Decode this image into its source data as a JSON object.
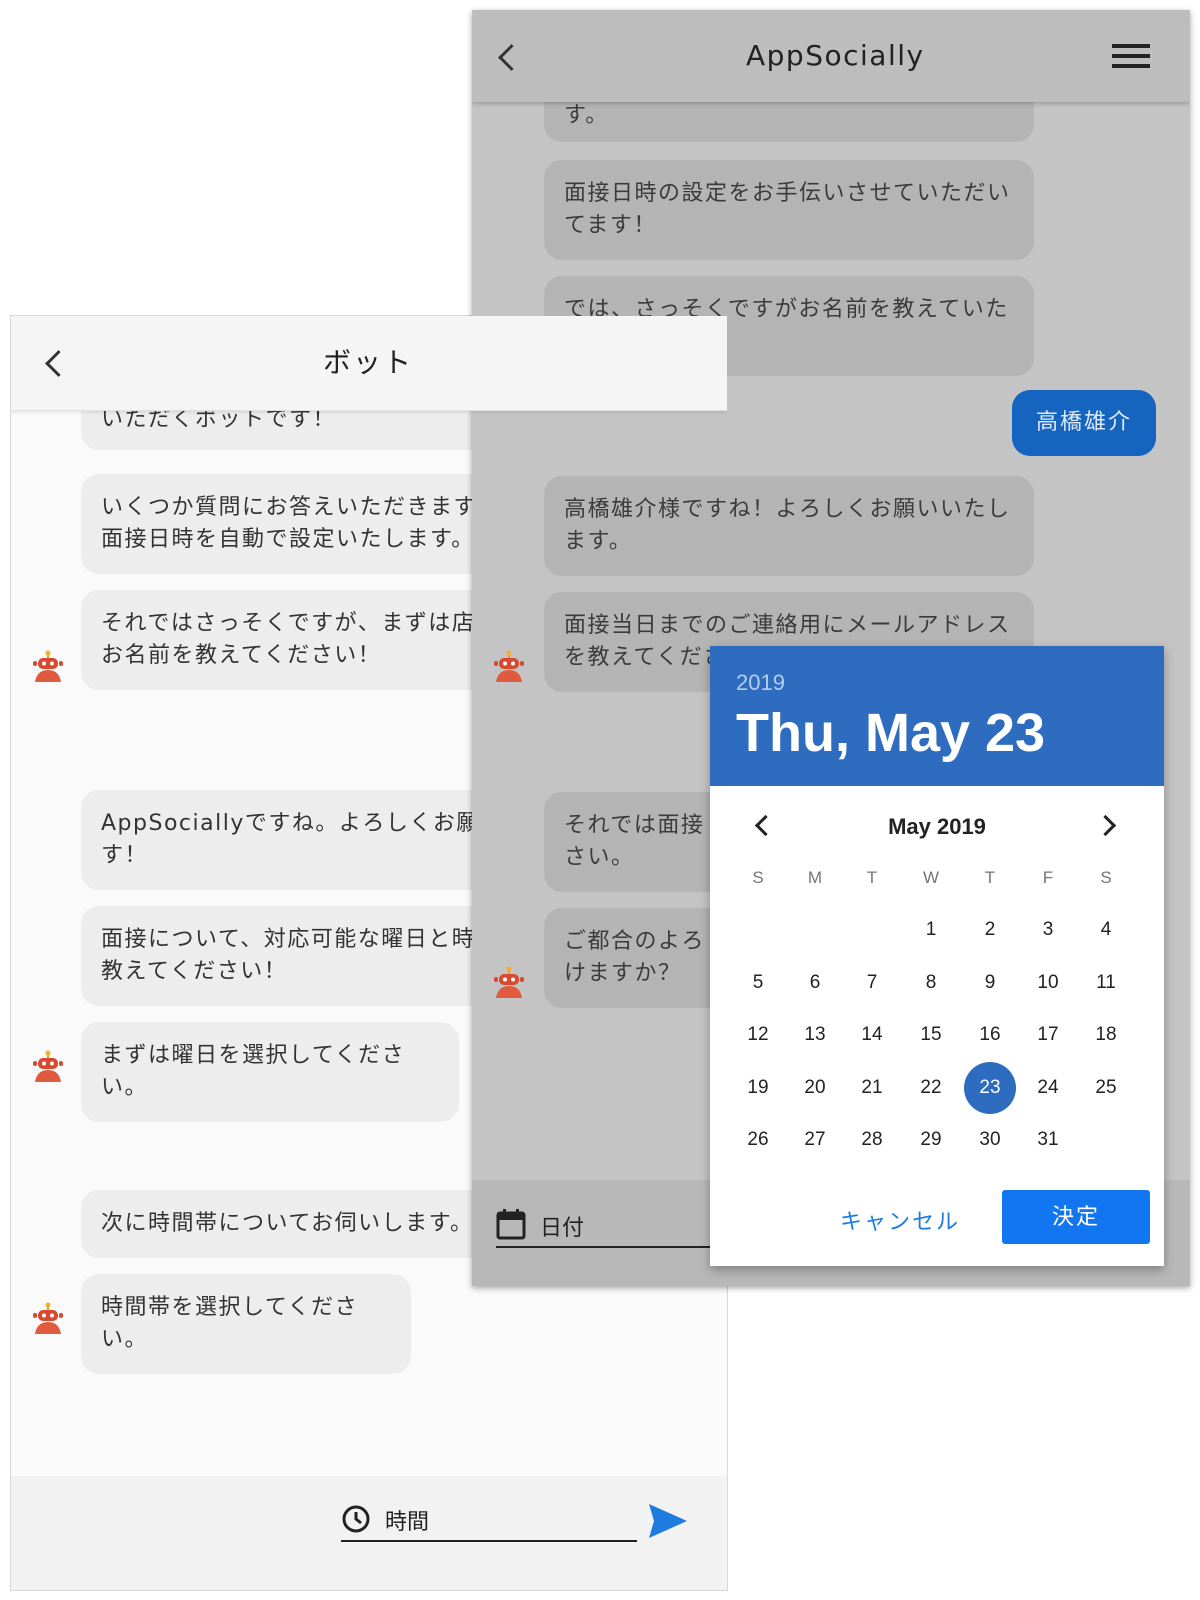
{
  "back_screen": {
    "title": "ボット",
    "messages": [
      "いただくボットです！",
      "いくつか質問にお答えいただきます\n面接日時を自動で設定いたします。",
      "それではさっそくですが、まずは店\nお名前を教えてください！",
      "AppSociallyですね。よろしくお願\nす！",
      "面接について、対応可能な曜日と時\n教えてください！",
      "まずは曜日を選択してください。",
      "次に時間帯についてお伺いします。",
      "時間帯を選択してください。"
    ],
    "time_input_label": "時間"
  },
  "front_screen": {
    "title": "AppSocially",
    "messages": [
      "す。",
      "面接日時の設定をお手伝いさせていただい\nてます！",
      "では、さっそくですがお名前を教えていた\nだけますか？",
      "高橋雄介様ですね！よろしくお願いいたし\nます。",
      "面接当日までのご連絡用にメールアドレス\nを教えてくださ",
      "それでは面接\nさい。",
      "ご都合のよろ\nけますか？"
    ],
    "user_message": "高橋雄介",
    "date_input_label": "日付"
  },
  "date_picker": {
    "year": "2019",
    "selected_date": "Thu, May 23",
    "month_label": "May 2019",
    "weekdays": [
      "S",
      "M",
      "T",
      "W",
      "T",
      "F",
      "S"
    ],
    "days": [
      "1",
      "2",
      "3",
      "4",
      "5",
      "6",
      "7",
      "8",
      "9",
      "10",
      "11",
      "12",
      "13",
      "14",
      "15",
      "16",
      "17",
      "18",
      "19",
      "20",
      "21",
      "22",
      "23",
      "24",
      "25",
      "26",
      "27",
      "28",
      "29",
      "30",
      "31"
    ],
    "first_weekday_index": 3,
    "selected_day": "23",
    "cancel_label": "キャンセル",
    "ok_label": "決定"
  },
  "colors": {
    "accent_blue": "#1176f0",
    "picker_header": "#2d6cbf",
    "user_bubble": "#1565c0",
    "bot_avatar": "#e05a3f"
  }
}
